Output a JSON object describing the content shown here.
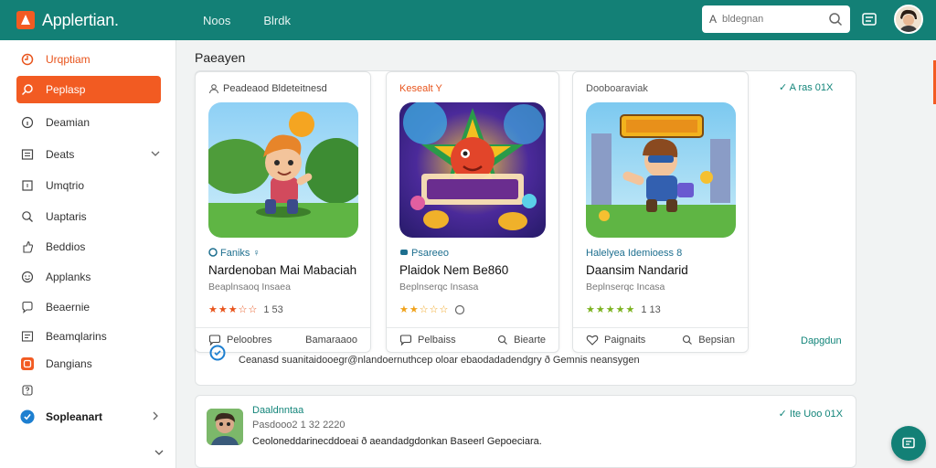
{
  "header": {
    "app_name": "Applertian.",
    "nav": [
      "Noos",
      "Blrdk"
    ],
    "search_letter": "A",
    "search_placeholder": "bldegnan"
  },
  "sidebar": {
    "items": [
      {
        "label": "Urqptiam",
        "icon": "refresh-icon"
      },
      {
        "label": "Peplasp",
        "icon": "search-icon"
      },
      {
        "label": "Deamian",
        "icon": "info-icon"
      },
      {
        "label": "Deats",
        "icon": "grid-icon"
      },
      {
        "label": "Umqtrio",
        "icon": "square-icon"
      },
      {
        "label": "Uaptaris",
        "icon": "search-icon"
      },
      {
        "label": "Beddios",
        "icon": "thumb-icon"
      },
      {
        "label": "Applanks",
        "icon": "smile-icon"
      },
      {
        "label": "Beaernie",
        "icon": "chat-icon"
      },
      {
        "label": "Beamqlarins",
        "icon": "image-icon"
      },
      {
        "label": "Dangians",
        "icon": "orange-app-icon"
      },
      {
        "label": "",
        "icon": "help-icon"
      },
      {
        "label": "Sopleanart",
        "icon": "blue-app-icon"
      }
    ]
  },
  "main": {
    "section_title": "Paeayen",
    "panel_right_link": "A ras 01X",
    "panel_right_link_check": "✓",
    "cards": [
      {
        "tag": "Peadeaod Bldeteitnesd",
        "category": "Faniks",
        "category_suffix": "♀",
        "title": "Nardenoban Mai Mabaciah",
        "subtitle": "Beaplnsaoq Insaea",
        "stars": "★★★☆☆",
        "rating": "1 53",
        "foot_left": "Peloobres",
        "foot_right": "Bamaraaoo"
      },
      {
        "tag": "Kesealt Y",
        "category": "Psareeo",
        "category_suffix": "",
        "title": "Plaidok Nem Be860",
        "subtitle": "Beplnserqc Insasa",
        "stars": "★★☆☆☆",
        "rating": "",
        "foot_left": "Pelbaiss",
        "foot_right": "Biearte"
      },
      {
        "tag": "Dooboaraviak",
        "category": "Halelyea Idemioess",
        "category_suffix": "8",
        "title": "Daansim Nandarid",
        "subtitle": "Beplnserqc Incasa",
        "stars": "★★★★★",
        "rating": "1 13",
        "foot_left": "Paignaits",
        "foot_right": "Bepsian"
      }
    ],
    "panel_footer_link": "Dapgdun",
    "description": "Ceanasd suanitaidooegr@nlandoernuthcep oloar ebaodadadendgry ð Gemnis neansygen",
    "post": {
      "name": "Daaldnntaa",
      "date": "Pasdooo2 1 32 2220",
      "body": "Ceoloneddarinecddoeai ð aeandadgdonkan Baseerl Gepoeciara.",
      "link": "Ite Uoo 01X"
    }
  },
  "colors": {
    "header": "#138076",
    "accent": "#f25b22",
    "link": "#13857a"
  }
}
